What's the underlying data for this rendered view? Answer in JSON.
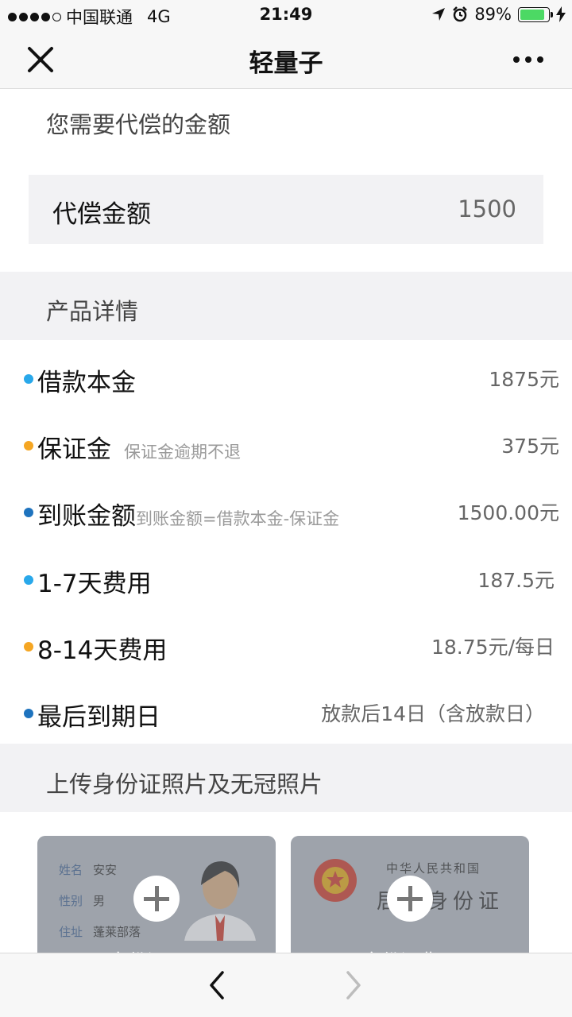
{
  "status_bar": {
    "carrier": "中国联通",
    "network": "4G",
    "time": "21:49",
    "battery": "89%",
    "battery_level": 0.89,
    "icons": [
      "signal-dots-icon",
      "location-arrow-icon",
      "alarm-clock-icon",
      "battery-icon",
      "charging-bolt-icon"
    ]
  },
  "nav": {
    "title": "轻量子",
    "close_icon": "close-icon",
    "more_icon": "more-icon"
  },
  "repay": {
    "section_title": "您需要代偿的金额",
    "amount_label": "代偿金额",
    "amount_value": "1500"
  },
  "details": {
    "section_title": "产品详情",
    "rows": [
      {
        "label": "借款本金",
        "note": "",
        "value": "1875元",
        "color": "#29a8ea"
      },
      {
        "label": "保证金",
        "note": "保证金逾期不退",
        "value": "375元",
        "color": "#f5a623"
      },
      {
        "label": "到账金额",
        "note": "到账金额=借款本金-保证金",
        "value": "1500.00元",
        "color": "#1e73be"
      },
      {
        "label": "1-7天费用",
        "note": "",
        "value": "187.5元",
        "color": "#29a8ea"
      },
      {
        "label": "8-14天费用",
        "note": "",
        "value": "18.75元/每日",
        "color": "#f5a623"
      },
      {
        "label": "最后到期日",
        "note": "",
        "value": "放款后14日（含放款日）",
        "color": "#1e73be"
      }
    ]
  },
  "upload": {
    "section_title": "上传身份证照片及无冠照片",
    "front": {
      "name_field": "姓名",
      "name_value": "安安",
      "gender_field": "性别",
      "gender_value": "男",
      "address_field": "住址",
      "address_value": "蓬莱部落",
      "caption": "身份证正面"
    },
    "back": {
      "nation_text": "中华人民共和国",
      "id_title": "居民身份证",
      "caption": "身份证背面"
    }
  },
  "toolbar": {
    "back_icon": "back-arrow-icon",
    "forward_icon": "forward-arrow-icon"
  }
}
